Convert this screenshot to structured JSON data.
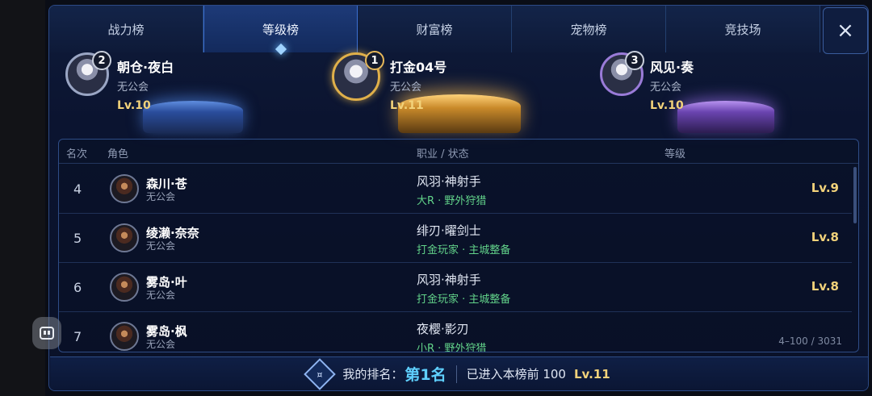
{
  "tabs": [
    {
      "label": "战力榜",
      "active": false
    },
    {
      "label": "等级榜",
      "active": true
    },
    {
      "label": "财富榜",
      "active": false
    },
    {
      "label": "宠物榜",
      "active": false
    },
    {
      "label": "竞技场",
      "active": false
    }
  ],
  "close_icon": "×",
  "podium": {
    "first": {
      "rank": "1",
      "name": "打金04号",
      "guild": "无公会",
      "level": "Lv.11"
    },
    "second": {
      "rank": "2",
      "name": "朝仓·夜白",
      "guild": "无公会",
      "level": "Lv.10"
    },
    "third": {
      "rank": "3",
      "name": "风见·奏",
      "guild": "无公会",
      "level": "Lv.10"
    }
  },
  "list": {
    "headers": {
      "rank": "名次",
      "role": "角色",
      "job": "职业 / 状态",
      "level": "等级"
    },
    "rows": [
      {
        "rank": "4",
        "name": "森川·苍",
        "guild": "无公会",
        "job": "风羽·神射手",
        "status": "大R · 野外狩猎",
        "level": "Lv.9"
      },
      {
        "rank": "5",
        "name": "绫濑·奈奈",
        "guild": "无公会",
        "job": "绯刃·曜剑士",
        "status": "打金玩家 · 主城整备",
        "level": "Lv.8"
      },
      {
        "rank": "6",
        "name": "雾岛·叶",
        "guild": "无公会",
        "job": "风羽·神射手",
        "status": "打金玩家 · 主城整备",
        "level": "Lv.8"
      },
      {
        "rank": "7",
        "name": "雾岛·枫",
        "guild": "无公会",
        "job": "夜樱·影刃",
        "status": "小R · 野外狩猎",
        "level": ""
      }
    ],
    "range": "4–100 / 3031"
  },
  "my_rank": {
    "label": "我的排名：",
    "rank": "第1名",
    "status": "已进入本榜前 100",
    "level": "Lv.11",
    "icon_glyph": "¤"
  }
}
